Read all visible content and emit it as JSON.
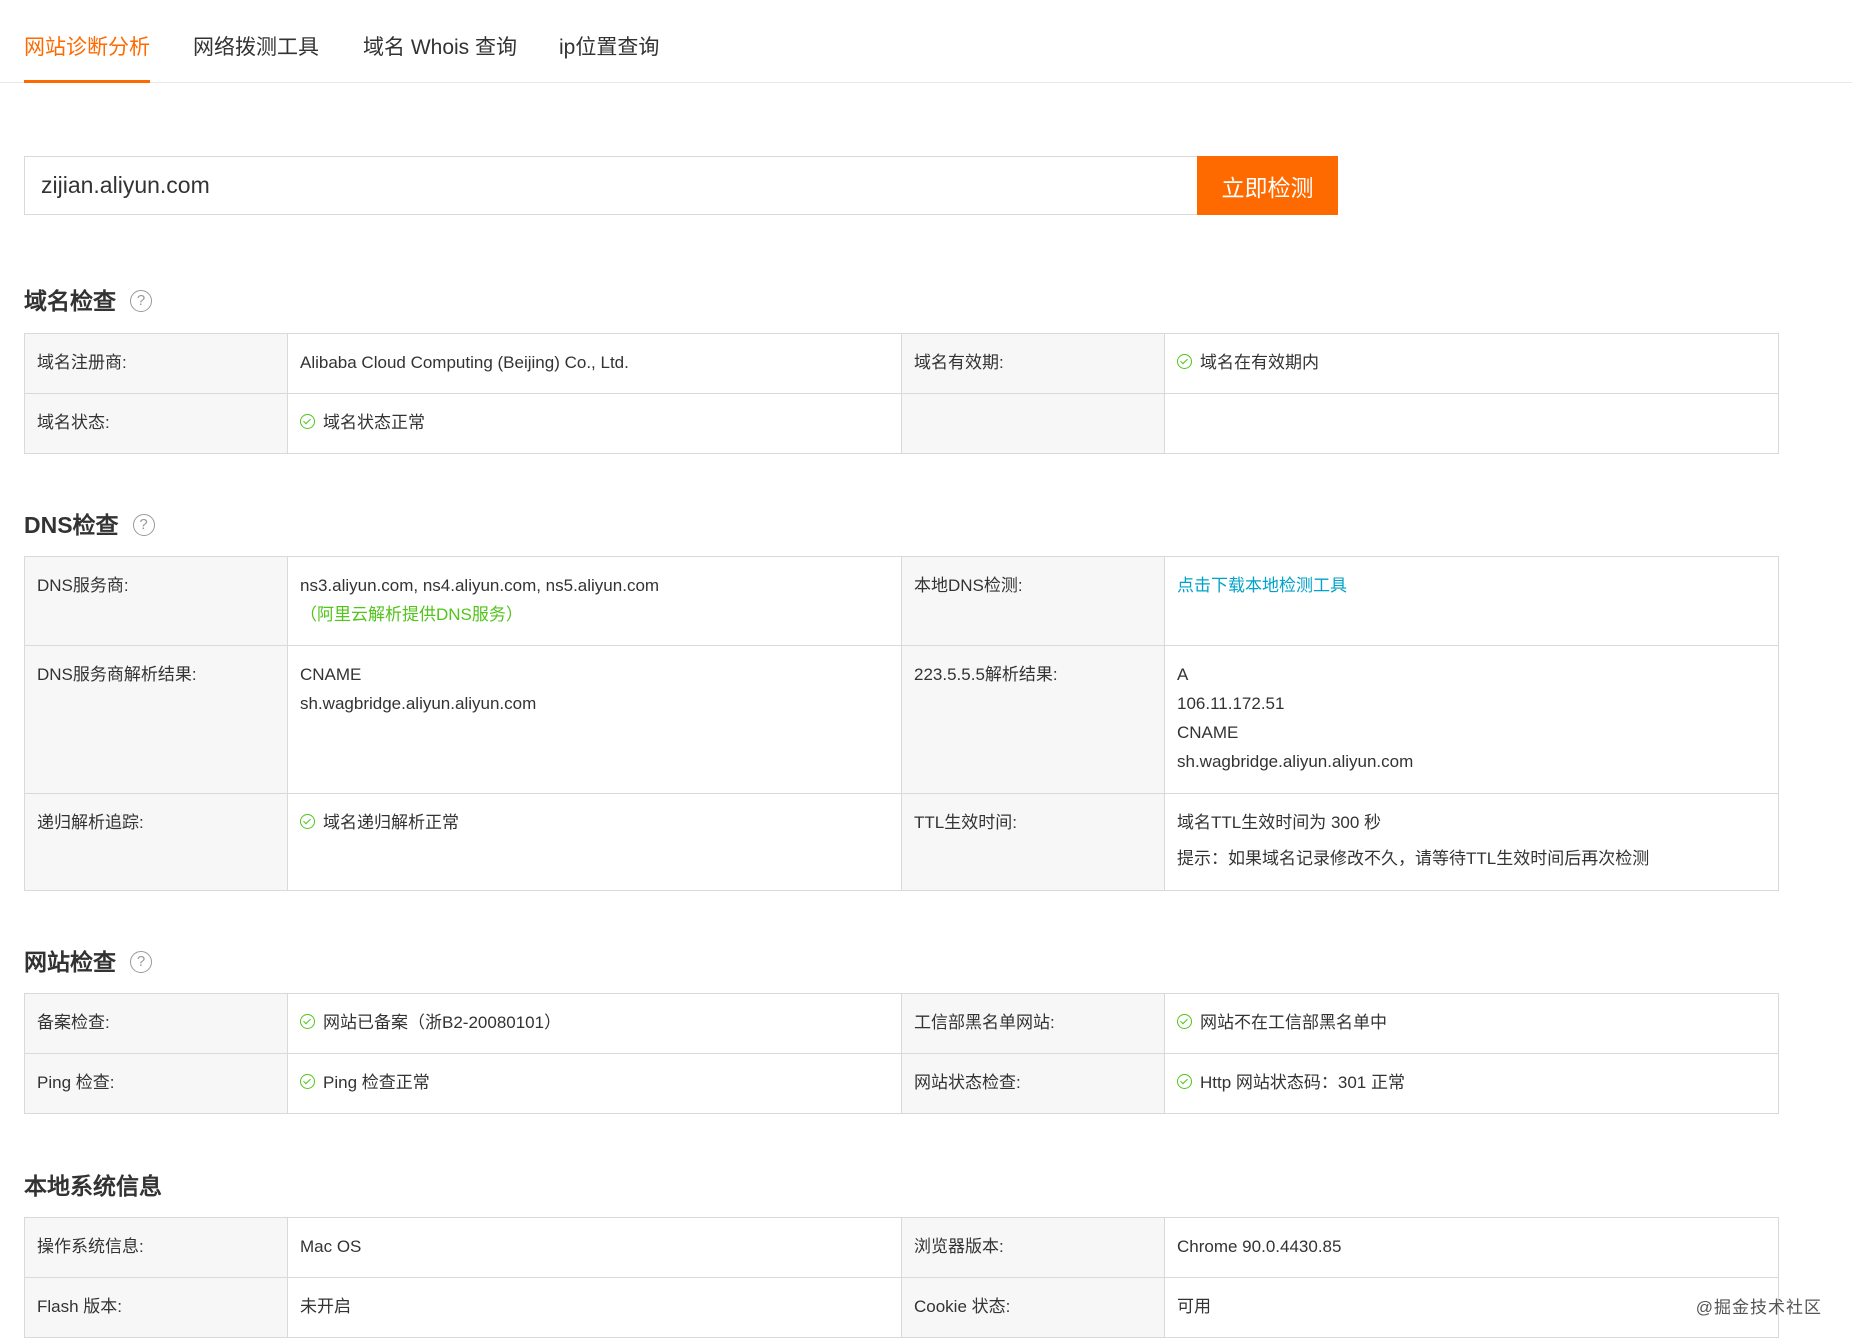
{
  "tabs": [
    "网站诊断分析",
    "网络拨测工具",
    "域名 Whois 查询",
    "ip位置查询"
  ],
  "search": {
    "value": "zijian.aliyun.com",
    "button": "立即检测"
  },
  "help_icon_glyph": "?",
  "sections": {
    "domain": {
      "title": "域名检查",
      "registrar_label": "域名注册商:",
      "registrar_value": "Alibaba Cloud Computing (Beijing) Co., Ltd.",
      "validity_label": "域名有效期:",
      "validity_value": "域名在有效期内",
      "status_label": "域名状态:",
      "status_value": "域名状态正常"
    },
    "dns": {
      "title": "DNS检查",
      "provider_label": "DNS服务商:",
      "provider_value": "ns3.aliyun.com, ns4.aliyun.com, ns5.aliyun.com",
      "provider_note": "（阿里云解析提供DNS服务）",
      "local_label": "本地DNS检测:",
      "local_link": "点击下载本地检测工具",
      "result_label": "DNS服务商解析结果:",
      "result_lines": [
        "CNAME",
        "sh.wagbridge.aliyun.aliyun.com"
      ],
      "r223_label": "223.5.5.5解析结果:",
      "r223_lines": [
        "A",
        "106.11.172.51",
        "CNAME",
        "sh.wagbridge.aliyun.aliyun.com"
      ],
      "recursive_label": "递归解析追踪:",
      "recursive_value": "域名递归解析正常",
      "ttl_label": "TTL生效时间:",
      "ttl_value": "域名TTL生效时间为 300 秒",
      "ttl_tip": "提示：如果域名记录修改不久，请等待TTL生效时间后再次检测"
    },
    "website": {
      "title": "网站检查",
      "icp_label": "备案检查:",
      "icp_value": "网站已备案（浙B2-20080101）",
      "blacklist_label": "工信部黑名单网站:",
      "blacklist_value": "网站不在工信部黑名单中",
      "ping_label": "Ping 检查:",
      "ping_value": "Ping 检查正常",
      "status_label": "网站状态检查:",
      "status_value": "Http 网站状态码：301 正常"
    },
    "local": {
      "title": "本地系统信息",
      "os_label": "操作系统信息:",
      "os_value": "Mac OS",
      "browser_label": "浏览器版本:",
      "browser_value": "Chrome 90.0.4430.85",
      "flash_label": "Flash 版本:",
      "flash_value": "未开启",
      "cookie_label": "Cookie 状态:",
      "cookie_value": "可用"
    }
  },
  "watermark": "@掘金技术社区",
  "colors": {
    "accent": "#ff6a00",
    "ok": "#52c41a",
    "link": "#00a2ca",
    "error": "#f5222d"
  }
}
